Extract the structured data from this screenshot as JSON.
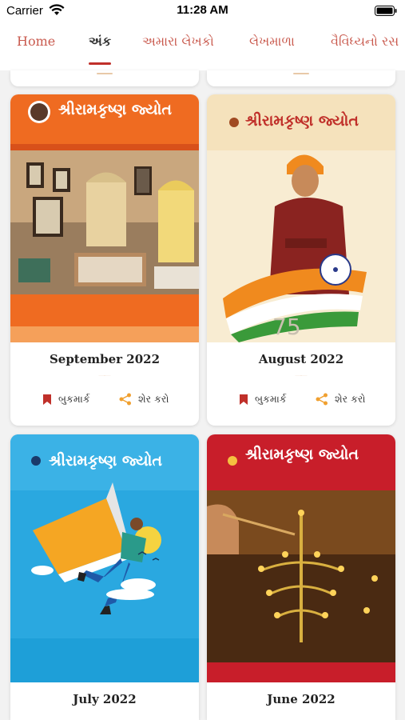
{
  "status_bar": {
    "carrier": "Carrier",
    "time": "11:28 AM"
  },
  "tabs": [
    {
      "label": "Home",
      "active": false
    },
    {
      "label": "અંક",
      "active": true
    },
    {
      "label": "અમારા લેખકો",
      "active": false
    },
    {
      "label": "લેખમાળા",
      "active": false
    },
    {
      "label": "વૈવિધ્યનો રસ",
      "active": false
    }
  ],
  "colors": {
    "accent": "#c0302a",
    "tab_inactive": "#c95a4e",
    "action_bookmark": "#c0302a",
    "action_share": "#f0a030"
  },
  "magazine_masthead": "શ્રીરામકૃષ્ણ જ્યોત",
  "issues": [
    {
      "title": "September 2022",
      "bookmark_label": "બુકમાર્ક",
      "share_label": "શેર કરો",
      "bookmark_icon": "bookmark-icon",
      "share_icon": "share-icon"
    },
    {
      "title": "August 2022",
      "bookmark_label": "બુકમાર્ક",
      "share_label": "શેર કરો",
      "bookmark_icon": "bookmark-icon",
      "share_icon": "share-icon"
    },
    {
      "title": "July 2022"
    },
    {
      "title": "June 2022"
    }
  ]
}
